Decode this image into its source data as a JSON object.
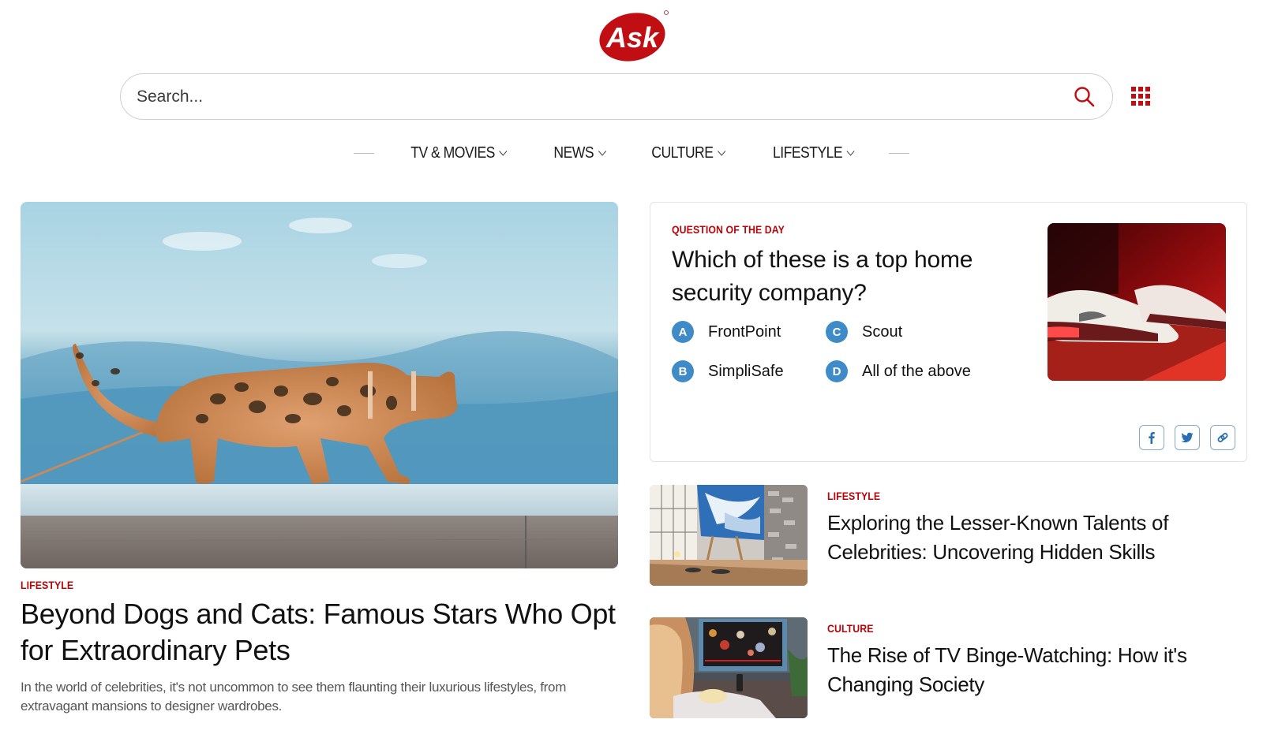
{
  "brand": {
    "logo_text": "Ask",
    "accent_color": "#c10e12"
  },
  "search": {
    "placeholder": "Search...",
    "value": "",
    "search_icon": "search-icon",
    "apps_icon": "apps-grid-icon"
  },
  "nav": {
    "items": [
      {
        "label": "TV & MOVIES",
        "icon": "chevron-down-icon"
      },
      {
        "label": "NEWS",
        "icon": "chevron-down-icon"
      },
      {
        "label": "CULTURE",
        "icon": "chevron-down-icon"
      },
      {
        "label": "LIFESTYLE",
        "icon": "chevron-down-icon"
      }
    ]
  },
  "hero": {
    "image": "bengal-cat-walking-on-ledge",
    "category": "LIFESTYLE",
    "title": "Beyond Dogs and Cats: Famous Stars Who Opt for Extraordinary Pets",
    "description": "In the world of celebrities, it's not uncommon to see them flaunting their luxurious lifestyles, from extravagant mansions to designer wardrobes."
  },
  "question_of_the_day": {
    "label": "QUESTION OF THE DAY",
    "question": "Which of these is a top home security company?",
    "answers": [
      {
        "letter": "A",
        "text": "FrontPoint"
      },
      {
        "letter": "C",
        "text": "Scout"
      },
      {
        "letter": "B",
        "text": "SimpliSafe"
      },
      {
        "letter": "D",
        "text": "All of the above"
      }
    ],
    "image": "sneakers-on-stage",
    "share": [
      {
        "icon": "facebook-icon",
        "label": "Share on Facebook"
      },
      {
        "icon": "twitter-icon",
        "label": "Share on Twitter"
      },
      {
        "icon": "link-icon",
        "label": "Copy link"
      }
    ],
    "badge_color": "#3f8bc8"
  },
  "side_articles": [
    {
      "image": "artist-studio-easel",
      "category": "LIFESTYLE",
      "title": "Exploring the Lesser-Known Talents of Celebrities: Uncovering Hidden Skills"
    },
    {
      "image": "woman-watching-tv",
      "category": "CULTURE",
      "title": "The Rise of TV Binge-Watching: How it's Changing Society"
    }
  ]
}
